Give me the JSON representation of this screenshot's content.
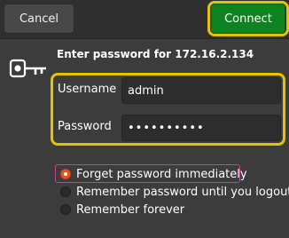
{
  "header": {
    "cancel_label": "Cancel",
    "connect_label": "Connect"
  },
  "auth": {
    "prompt": "Enter password for 172.16.2.134",
    "username_label": "Username",
    "username_value": "admin",
    "password_label": "Password",
    "password_value": "••••••••••"
  },
  "remember": {
    "options": [
      {
        "label": "Forget password immediately",
        "selected": true
      },
      {
        "label": "Remember password until you logout",
        "selected": false
      },
      {
        "label": "Remember forever",
        "selected": false
      }
    ]
  },
  "colors": {
    "connect": "#0e8420",
    "highlight": "#e8c200",
    "radio_selected": "#e95420"
  },
  "icons": {
    "auth": "key-icon"
  }
}
